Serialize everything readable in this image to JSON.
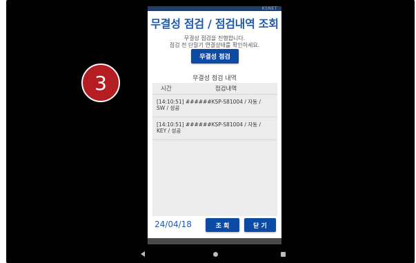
{
  "step_badge": "3",
  "app": {
    "brand": "KSNET",
    "title": "무결성 점검 / 점검내역 조회",
    "message_line1": "무결성 점검을 진행합니다.",
    "message_line2": "점검 전 단말기 연결상태를 확인하세요.",
    "check_button": "무결성 점검",
    "history_title": "무결성 점검 내역",
    "columns": {
      "time": "시간",
      "detail": "점검내역"
    },
    "history": [
      {
        "line1": "[14:10:51]  ######KSP-S81004 / 자동 /",
        "line2": "SW / 성공"
      },
      {
        "line1": "[14:10:51]  ######KSP-S81004 / 자동 /",
        "line2": "KEY / 성공"
      }
    ],
    "date": "24/04/18",
    "query_button": "조 회",
    "close_button": "닫 기"
  },
  "nav_icons": [
    "back-icon",
    "home-icon",
    "recents-icon"
  ],
  "colors": {
    "accent": "#1f5aa8",
    "button": "#0d4aa6",
    "badge": "#b51d22",
    "panel": "#ececec"
  }
}
